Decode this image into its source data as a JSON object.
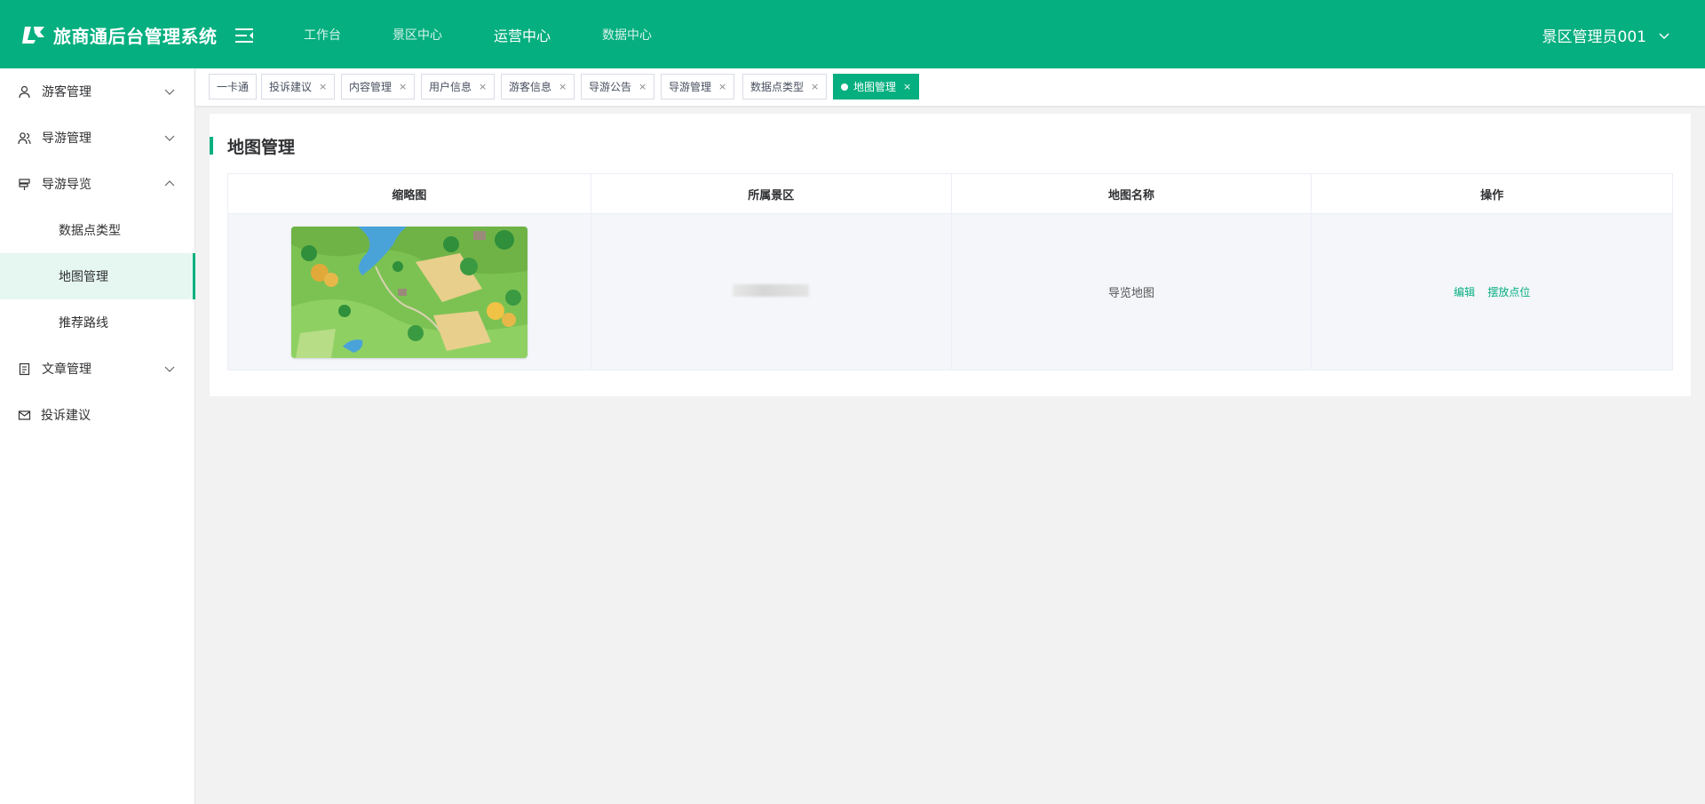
{
  "app": {
    "title": "旅商通后台管理系统"
  },
  "topnav": {
    "items": [
      {
        "label": "工作台"
      },
      {
        "label": "景区中心"
      },
      {
        "label": "运营中心"
      },
      {
        "label": "数据中心"
      }
    ],
    "active": "运营中心"
  },
  "user": {
    "name": "景区管理员001"
  },
  "sidebar": {
    "items": [
      {
        "label": "游客管理",
        "icon": "user-icon",
        "expanded": false
      },
      {
        "label": "导游管理",
        "icon": "users-icon",
        "expanded": false
      },
      {
        "label": "导游导览",
        "icon": "signpost-icon",
        "expanded": true
      },
      {
        "label": "文章管理",
        "icon": "document-icon",
        "expanded": false
      },
      {
        "label": "投诉建议",
        "icon": "mail-icon"
      }
    ],
    "subitems": [
      {
        "label": "数据点类型"
      },
      {
        "label": "地图管理",
        "active": true
      },
      {
        "label": "推荐路线"
      }
    ]
  },
  "tabs": [
    {
      "label": "一卡通",
      "closable": false
    },
    {
      "label": "投诉建议",
      "closable": true
    },
    {
      "label": "内容管理",
      "closable": true
    },
    {
      "label": "用户信息",
      "closable": true
    },
    {
      "label": "游客信息",
      "closable": true
    },
    {
      "label": "导游公告",
      "closable": true
    },
    {
      "label": "导游管理",
      "closable": true
    },
    {
      "label": "数据点类型",
      "closable": true
    },
    {
      "label": "地图管理",
      "closable": true,
      "active": true
    }
  ],
  "tab_close_glyph": "×",
  "page": {
    "title": "地图管理"
  },
  "table": {
    "headers": [
      "缩略图",
      "所属景区",
      "地图名称",
      "操作"
    ],
    "rows": [
      {
        "scenic_area": "",
        "map_name": "导览地图"
      }
    ],
    "actions": [
      "编辑",
      "摆放点位"
    ]
  },
  "colors": {
    "primary": "#05af7f",
    "active_menu_bg": "#e6f7f1"
  }
}
